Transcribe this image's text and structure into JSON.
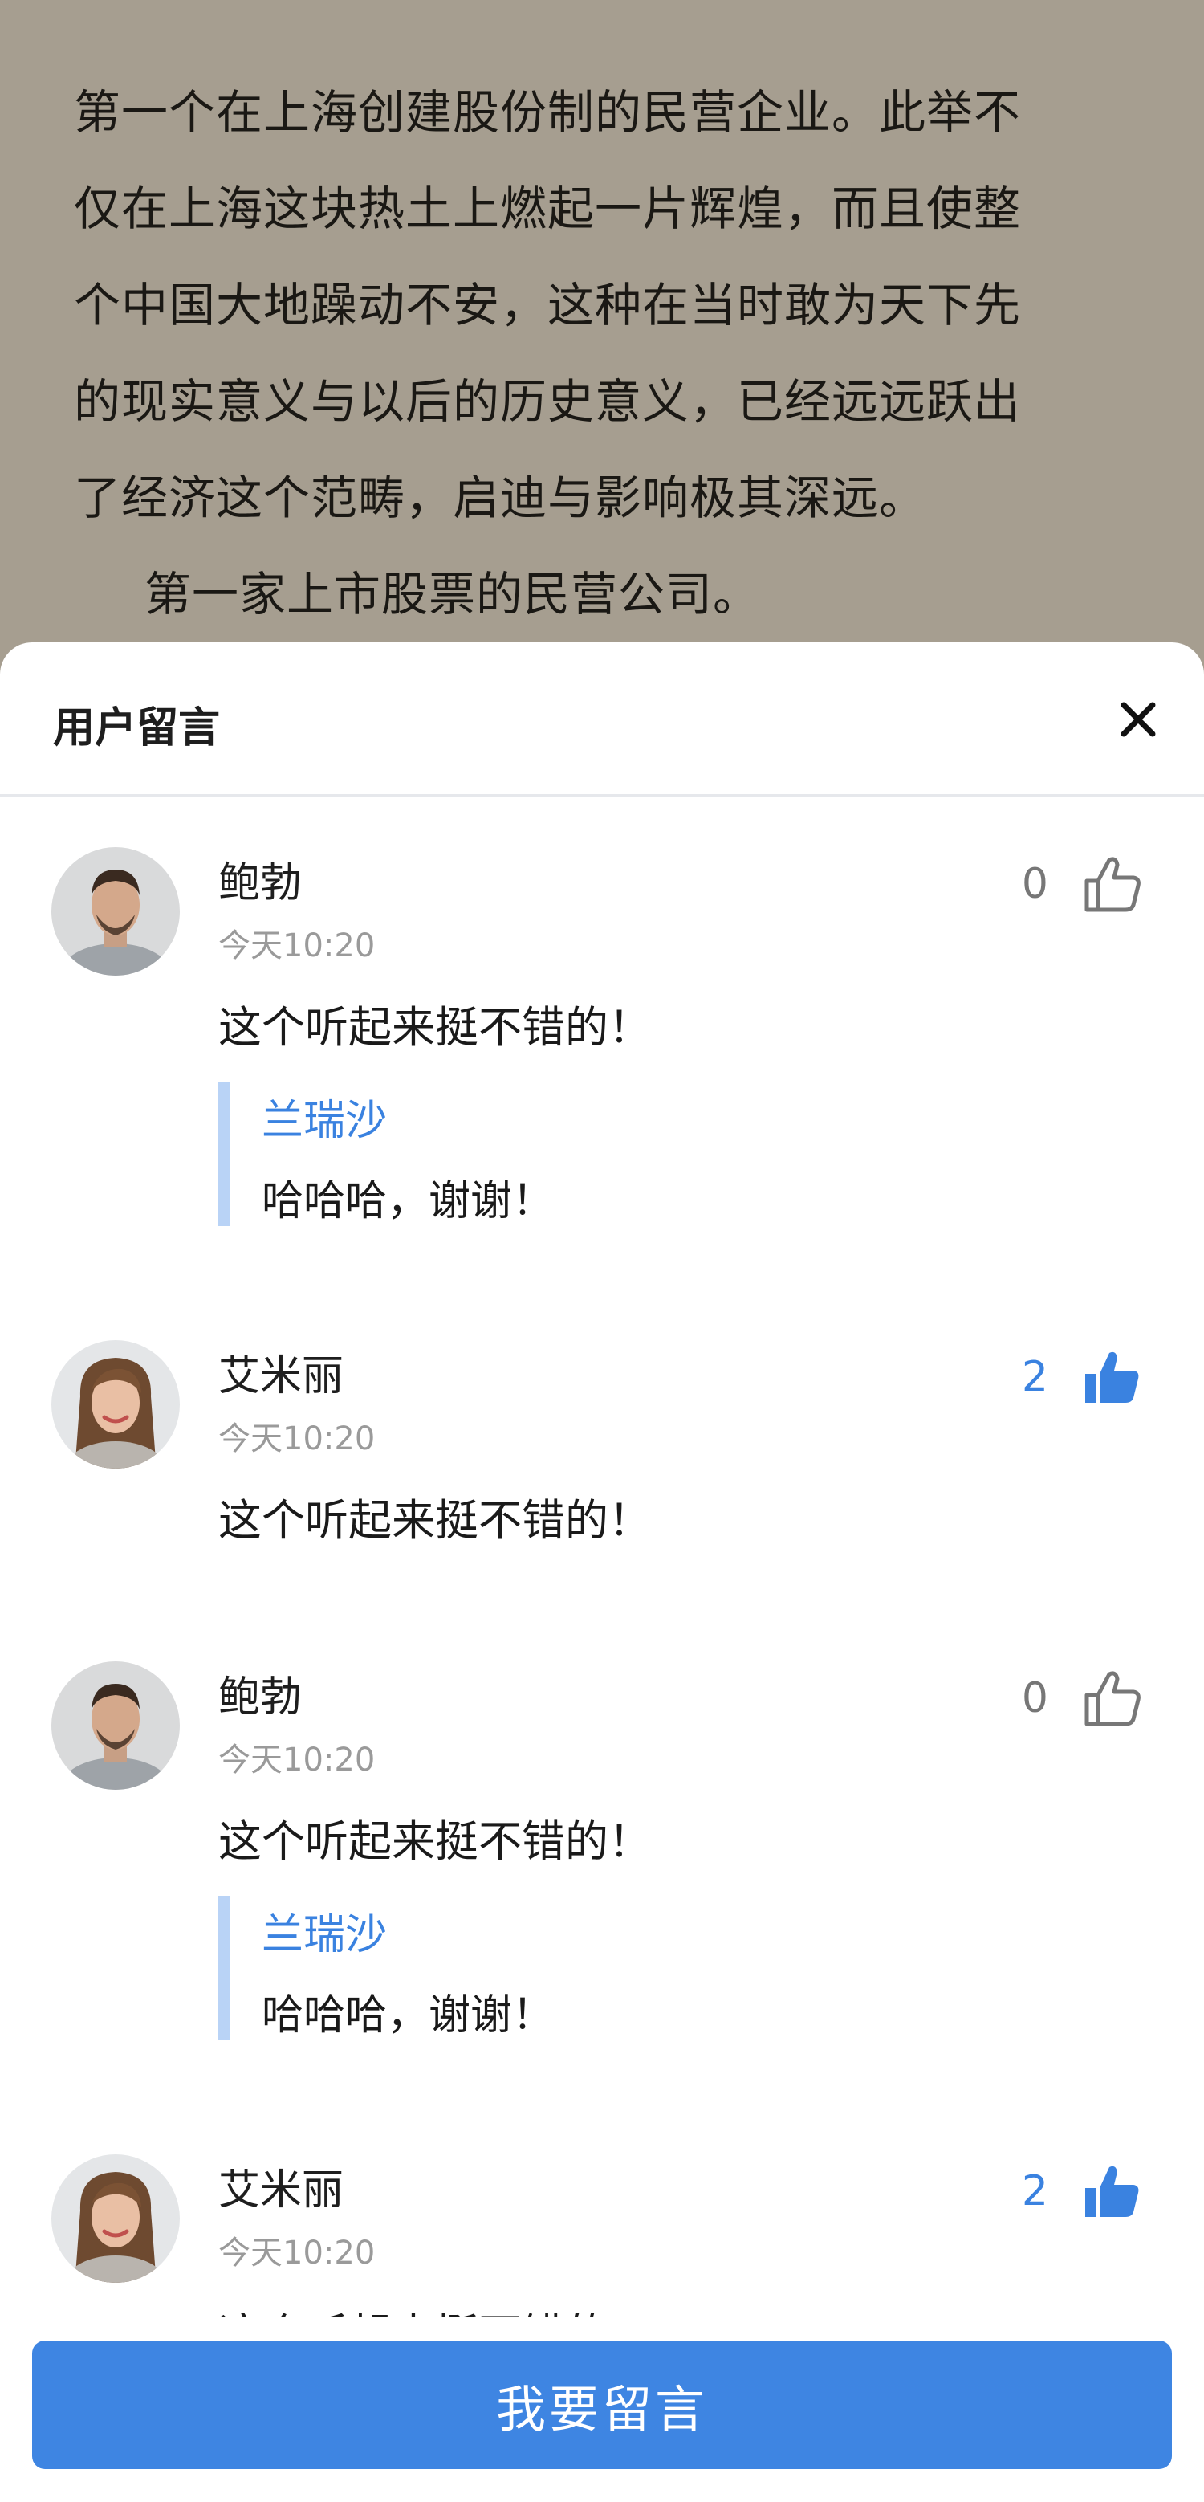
{
  "article": {
    "lines": [
      "第一个在上海创建股份制的民营企业。此举不",
      "仅在上海这块热土上燃起一片辉煌，而且使整",
      "个中国大地躁动不安，这种在当时敢为天下先",
      "的现实意义与以后的历史意义，已经远远跃出",
      "了经济这个范畴，启迪与影响极其深远。"
    ],
    "indent_line": "第一家上市股票的民营公司。"
  },
  "sheet": {
    "title": "用户留言",
    "close_icon": "close-icon"
  },
  "comments": [
    {
      "author": "鲍勃",
      "time": "今天10:20",
      "text": "这个听起来挺不错的！",
      "likes": "0",
      "liked": false,
      "reply": {
        "name": "兰瑞沙",
        "text": "哈哈哈，谢谢！"
      }
    },
    {
      "author": "艾米丽",
      "time": "今天10:20",
      "text": "这个听起来挺不错的！",
      "likes": "2",
      "liked": true
    },
    {
      "author": "鲍勃",
      "time": "今天10:20",
      "text": "这个听起来挺不错的！",
      "likes": "0",
      "liked": false,
      "reply": {
        "name": "兰瑞沙",
        "text": "哈哈哈，谢谢！"
      }
    },
    {
      "author": "艾米丽",
      "time": "今天10:20",
      "text": "这个听起来挺不错的！",
      "likes": "2",
      "liked": true
    }
  ],
  "footer": {
    "button_label": "我要留言"
  },
  "colors": {
    "accent": "#3e85e2",
    "reply_name": "#3a82e0",
    "reply_bar": "#b9d3f6",
    "overlay_bg": "#a69e90"
  }
}
